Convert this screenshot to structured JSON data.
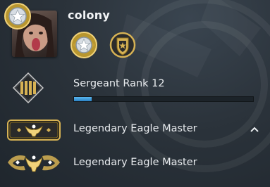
{
  "profile": {
    "username": "colony"
  },
  "rank": {
    "label": "Sergeant Rank 12",
    "xp_progress": 0.1
  },
  "competitive": {
    "primary_rank": "Legendary Eagle Master",
    "secondary_rank": "Legendary Eagle Master"
  },
  "icons": {
    "corner_coin": "silver-star-coin-icon",
    "coin_1": "silver-star-coin-icon",
    "coin_2": "gold-shield-coin-icon",
    "rank_badge": "sergeant-chevron-icon",
    "skill_1": "legendary-eagle-master-icon",
    "skill_2": "legendary-eagle-master-icon",
    "toggle": "chevron-up-icon"
  },
  "colors": {
    "xp_fill": "#3a9ad8",
    "gold": "#d6b254"
  }
}
